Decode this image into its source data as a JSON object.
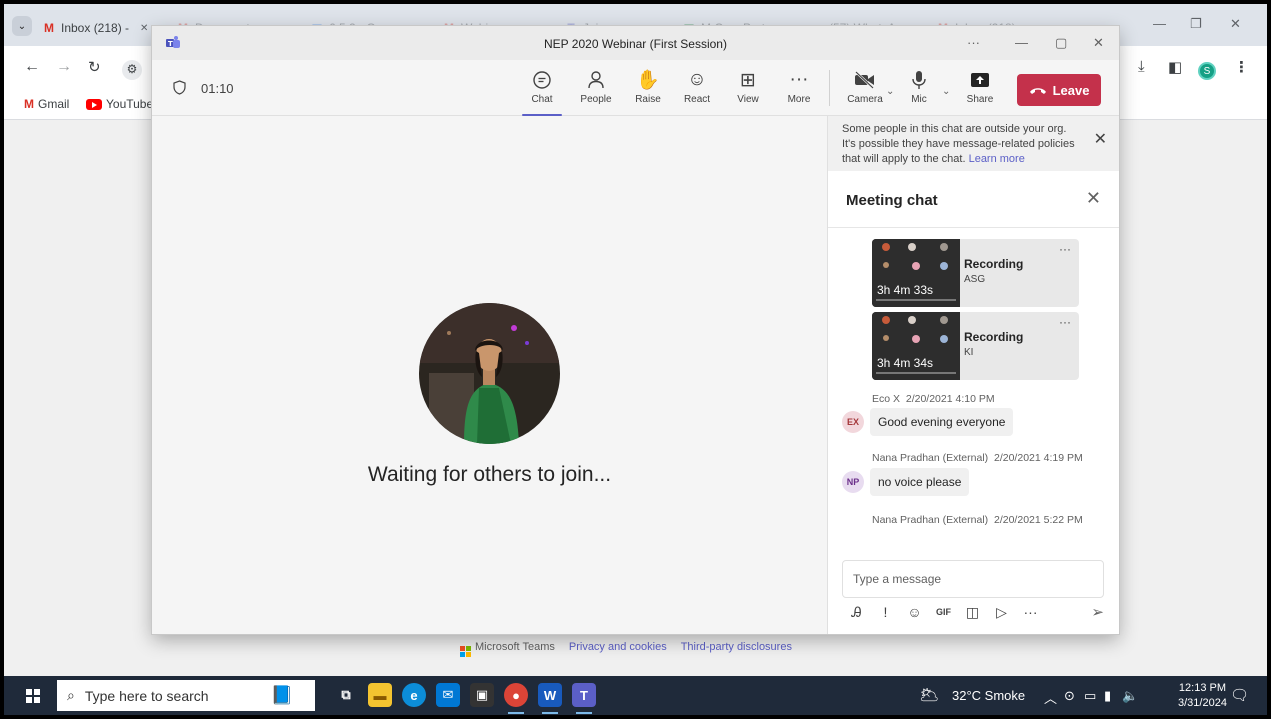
{
  "browser": {
    "tabs": [
      {
        "label": "Inbox (218) -",
        "icon": "gmail-icon"
      },
      {
        "label": "Document",
        "icon": "gmail-icon"
      },
      {
        "label": "6.5.2 - Goo",
        "icon": "docs-icon"
      },
      {
        "label": "Webinar on",
        "icon": "gmail-icon"
      },
      {
        "label": "Join conv",
        "icon": "teams-icon"
      },
      {
        "label": "M.Com Part",
        "icon": "sheets-icon"
      },
      {
        "label": "(57) WhatsA",
        "icon": "whatsapp-icon"
      },
      {
        "label": "Inbox (218)",
        "icon": "gmail-icon"
      }
    ],
    "bookmarks": [
      {
        "label": "Gmail",
        "icon": "gmail-icon"
      },
      {
        "label": "YouTube",
        "icon": "youtube-icon"
      }
    ],
    "profile_initial": "S"
  },
  "teams": {
    "window_title": "NEP 2020 Webinar (First Session)",
    "timer": "01:10",
    "toolbar": [
      {
        "label": "Chat",
        "icon": "chat-icon",
        "active": true
      },
      {
        "label": "People",
        "icon": "people-icon"
      },
      {
        "label": "Raise",
        "icon": "hand-icon"
      },
      {
        "label": "React",
        "icon": "smiley-icon"
      },
      {
        "label": "View",
        "icon": "grid-icon"
      },
      {
        "label": "More",
        "icon": "more-icon"
      }
    ],
    "devices": [
      {
        "label": "Camera",
        "icon": "camera-off-icon"
      },
      {
        "label": "Mic",
        "icon": "mic-icon"
      },
      {
        "label": "Share",
        "icon": "share-icon"
      }
    ],
    "leave_label": "Leave",
    "waiting_text": "Waiting for others to join...",
    "notice": {
      "text": "Some people in this chat are outside your org. It's possible they have message-related policies that will apply to the chat.",
      "link": "Learn more"
    },
    "chat_title": "Meeting chat",
    "recordings": [
      {
        "title": "Recording",
        "subtitle": "ASG",
        "duration": "3h 4m 33s"
      },
      {
        "title": "Recording",
        "subtitle": "KI",
        "duration": "3h 4m 34s"
      }
    ],
    "messages": [
      {
        "initials": "EX",
        "sender": "Eco X",
        "time": "2/20/2021 4:10 PM",
        "text": "Good evening everyone",
        "avatar_bg": "#f2d7dc",
        "avatar_fg": "#a4373a"
      },
      {
        "initials": "NP",
        "sender": "Nana Pradhan (External)",
        "time": "2/20/2021 4:19 PM",
        "text": "no voice please",
        "avatar_bg": "#e8dcf0",
        "avatar_fg": "#6b2f8a"
      }
    ],
    "last_meta": {
      "sender": "Nana Pradhan (External)",
      "time": "2/20/2021 5:22 PM"
    },
    "compose_placeholder": "Type a message"
  },
  "footer": {
    "brand": "Microsoft Teams",
    "privacy": "Privacy and cookies",
    "disclosures": "Third-party disclosures"
  },
  "taskbar": {
    "search_placeholder": "Type here to search",
    "weather": "32°C  Smoke",
    "time": "12:13 PM",
    "date": "3/31/2024"
  }
}
